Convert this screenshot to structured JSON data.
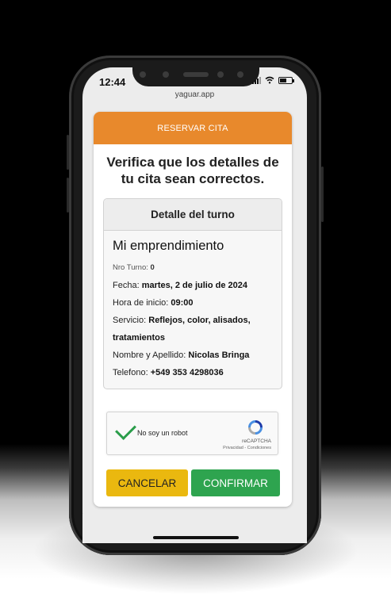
{
  "status_bar": {
    "time": "12:44"
  },
  "browser": {
    "url": "yaguar.app"
  },
  "card": {
    "header_title": "RESERVAR CITA",
    "heading": "Verifica que los detalles de tu cita sean correctos."
  },
  "detail": {
    "title": "Detalle del turno",
    "business_name": "Mi emprendimiento",
    "rows": [
      {
        "label": "Nro Turno: ",
        "value": "0"
      },
      {
        "label": "Fecha: ",
        "value": "martes, 2 de julio de 2024"
      },
      {
        "label": "Hora de inicio: ",
        "value": "09:00"
      },
      {
        "label": "Servicio: ",
        "value": "Reflejos, color, alisados, tratamientos"
      },
      {
        "label": "Nombre y Apellido: ",
        "value": "Nicolas Bringa"
      },
      {
        "label": "Telefono: ",
        "value": "+549 353 4298036"
      }
    ]
  },
  "captcha": {
    "label": "No soy un robot",
    "brand": "reCAPTCHA",
    "links": "Privacidad - Condiciones"
  },
  "buttons": {
    "cancel": "CANCELAR",
    "confirm": "CONFIRMAR"
  },
  "colors": {
    "header_orange": "#e8892c",
    "cancel_yellow": "#eab80f",
    "confirm_green": "#2ea44f",
    "check_green": "#2a9d4a"
  },
  "icons": [
    "signal-icon",
    "wifi-icon",
    "battery-icon",
    "checkmark-icon",
    "recaptcha-logo-icon"
  ]
}
